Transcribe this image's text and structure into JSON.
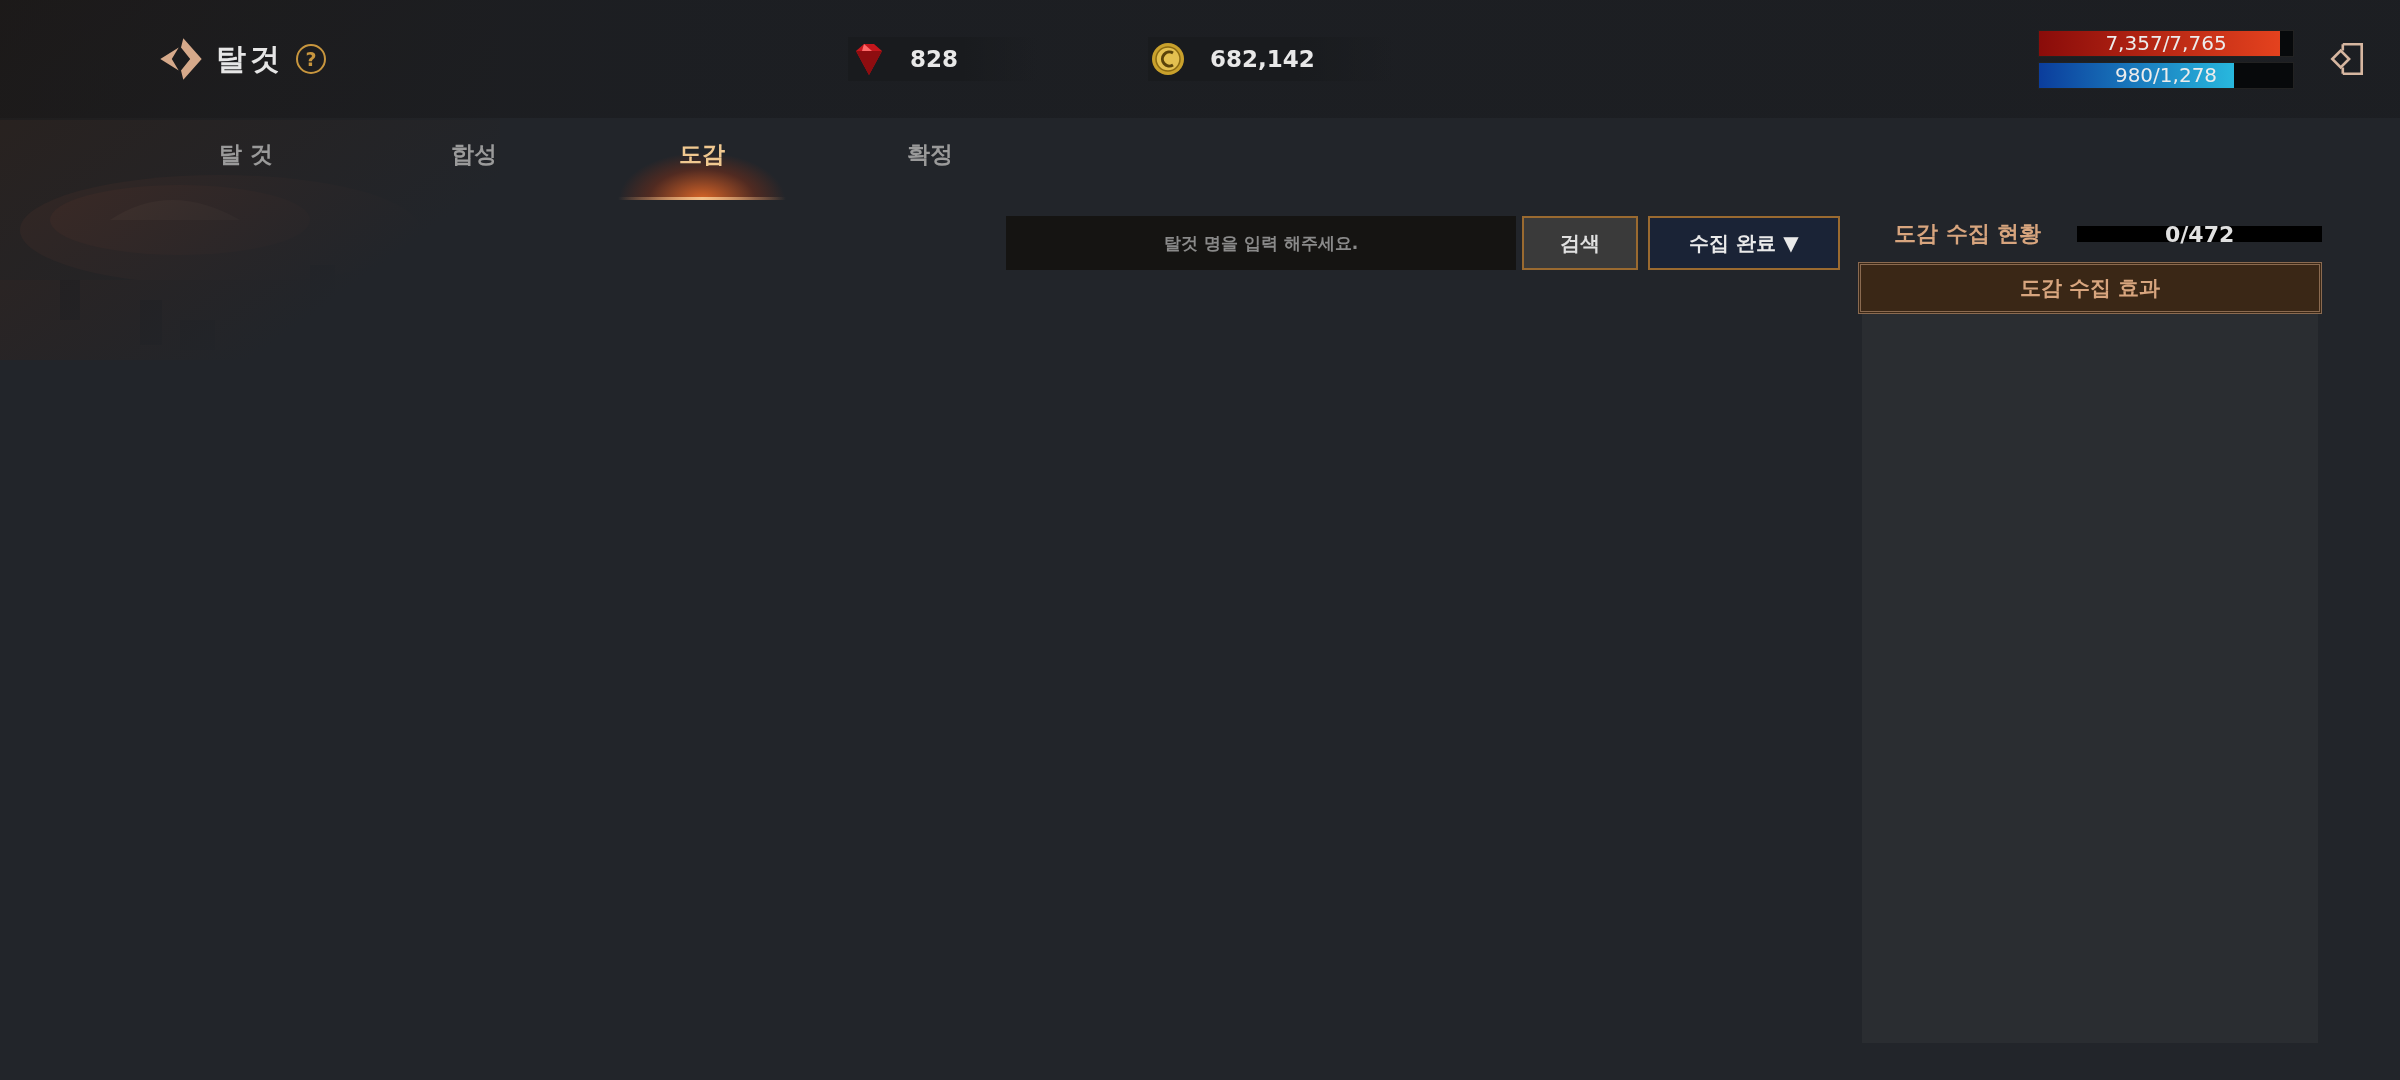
{
  "header": {
    "title": "탈것",
    "help": "?"
  },
  "currencies": [
    {
      "kind": "gem",
      "amount": "828"
    },
    {
      "kind": "gold",
      "amount": "682,142"
    }
  ],
  "bars": [
    {
      "kind": "hp",
      "reading": "7,357/7,765",
      "level": 0.947
    },
    {
      "kind": "mp",
      "reading": "980/1,278",
      "level": 0.767
    }
  ],
  "tabs": [
    {
      "label": "탈 것",
      "selected": false
    },
    {
      "label": "합성",
      "selected": false
    },
    {
      "label": "도감",
      "selected": true
    },
    {
      "label": "확정",
      "selected": false
    }
  ],
  "search": {
    "placeholder": "탈것 명을 입력 해주세요.",
    "button": "검색",
    "filter": "수집 완료 ▼"
  },
  "collection": {
    "label": "도감 수집 현황",
    "reading": "0/472",
    "level": 0,
    "effects_title": "도감 수집 효과"
  }
}
